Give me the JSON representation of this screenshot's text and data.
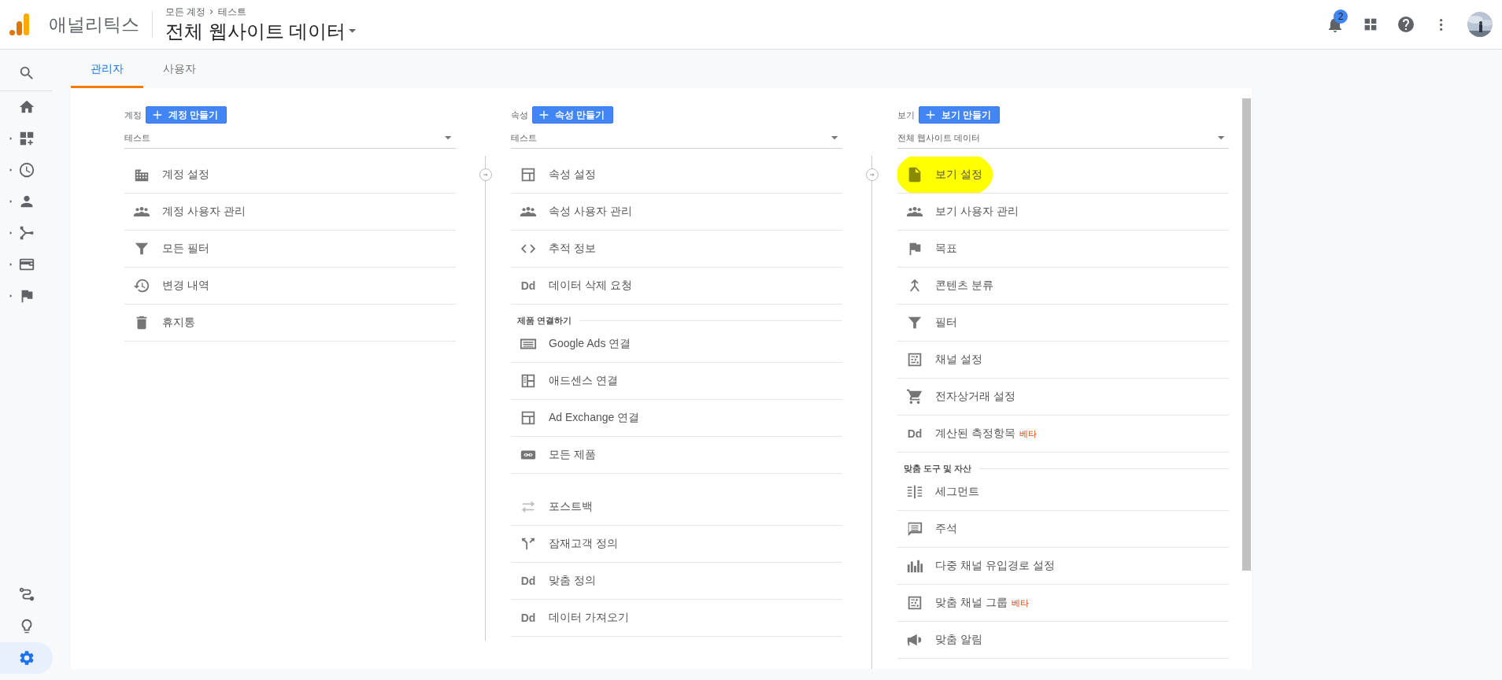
{
  "header": {
    "product_name": "애널리틱스",
    "breadcrumb": [
      "모든 계정",
      "테스트"
    ],
    "title": "전체 웹사이트 데이터",
    "notification_count": "2"
  },
  "sidebar": {
    "top_items": [
      {
        "expandable": false,
        "selected": false
      },
      {
        "expandable": false,
        "selected": false
      },
      {
        "expandable": true,
        "selected": false
      },
      {
        "expandable": true,
        "selected": false
      },
      {
        "expandable": true,
        "selected": false
      },
      {
        "expandable": true,
        "selected": false
      },
      {
        "expandable": true,
        "selected": false
      },
      {
        "expandable": true,
        "selected": false
      }
    ],
    "bottom_items": [
      {
        "expandable": false,
        "selected": false
      },
      {
        "expandable": false,
        "selected": false
      },
      {
        "expandable": false,
        "selected": true
      }
    ]
  },
  "tabs": [
    {
      "label": "관리자",
      "selected": true
    },
    {
      "label": "사용자",
      "selected": false
    }
  ],
  "columns": [
    {
      "label": "계정",
      "create_button": "계정 만들기",
      "selector_value": "테스트",
      "groups": [
        {
          "kind": "plain",
          "items": [
            {
              "label": "계정 설정",
              "highlighted": false
            },
            {
              "label": "계정 사용자 관리",
              "highlighted": false
            },
            {
              "label": "모든 필터",
              "highlighted": false
            },
            {
              "label": "변경 내역",
              "highlighted": false
            },
            {
              "label": "휴지통",
              "highlighted": false
            }
          ]
        }
      ]
    },
    {
      "label": "속성",
      "create_button": "속성 만들기",
      "selector_value": "테스트",
      "groups": [
        {
          "kind": "plain",
          "items": [
            {
              "label": "속성 설정",
              "highlighted": false
            },
            {
              "label": "속성 사용자 관리",
              "highlighted": false
            },
            {
              "label": "추적 정보",
              "highlighted": false
            },
            {
              "label": "데이터 삭제 요청",
              "icon_text": "Dd",
              "highlighted": false
            }
          ]
        },
        {
          "kind": "titled",
          "title": "제품 연결하기",
          "items": [
            {
              "label": "Google Ads 연결",
              "highlighted": false
            },
            {
              "label": "애드센스 연결",
              "highlighted": false
            },
            {
              "label": "Ad Exchange 연결",
              "highlighted": false
            },
            {
              "label": "모든 제품",
              "highlighted": false
            }
          ]
        },
        {
          "kind": "spaced",
          "items": [
            {
              "label": "포스트백",
              "highlighted": false
            },
            {
              "label": "잠재고객 정의",
              "highlighted": false
            },
            {
              "label": "맞춤 정의",
              "icon_text": "Dd",
              "highlighted": false
            },
            {
              "label": "데이터 가져오기",
              "icon_text": "Dd",
              "highlighted": false
            }
          ]
        }
      ]
    },
    {
      "label": "보기",
      "create_button": "보기 만들기",
      "selector_value": "전체 웹사이트 데이터",
      "groups": [
        {
          "kind": "plain",
          "items": [
            {
              "label": "보기 설정",
              "highlighted": true
            },
            {
              "label": "보기 사용자 관리",
              "highlighted": false
            },
            {
              "label": "목표",
              "highlighted": false
            },
            {
              "label": "콘텐츠 분류",
              "highlighted": false
            },
            {
              "label": "필터",
              "highlighted": false
            },
            {
              "label": "채널 설정",
              "highlighted": false
            },
            {
              "label": "전자상거래 설정",
              "highlighted": false
            },
            {
              "label": "계산된 측정항목",
              "icon_text": "Dd",
              "badge": "베타",
              "highlighted": false
            }
          ]
        },
        {
          "kind": "titled",
          "title": "맞춤 도구 및 자산",
          "items": [
            {
              "label": "세그먼트",
              "highlighted": false
            },
            {
              "label": "주석",
              "highlighted": false
            },
            {
              "label": "다중 채널 유입경로 설정",
              "highlighted": false
            },
            {
              "label": "맞춤 채널 그룹",
              "badge": "베타",
              "highlighted": false
            },
            {
              "label": "맞춤 알림",
              "highlighted": false
            }
          ]
        }
      ]
    }
  ]
}
